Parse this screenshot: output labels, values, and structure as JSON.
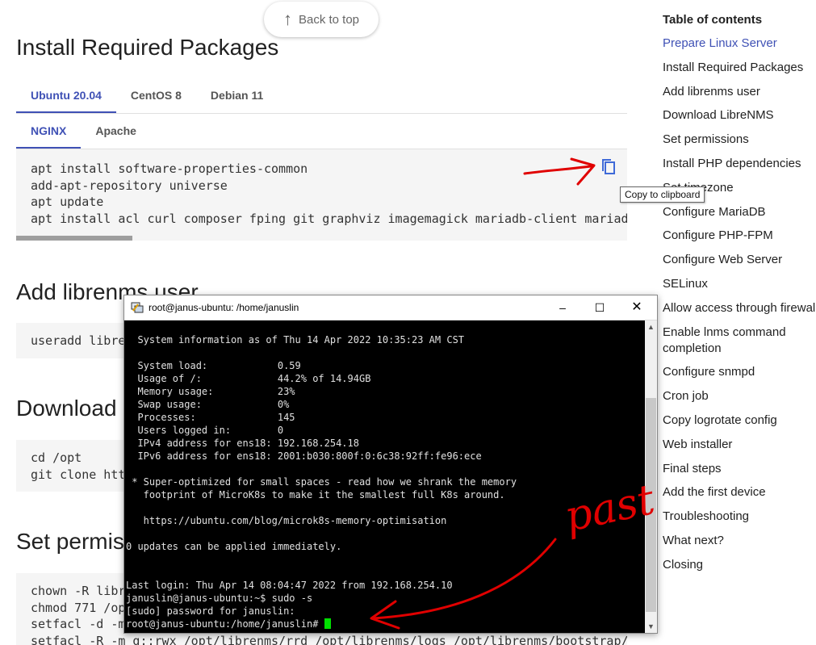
{
  "back_to_top": {
    "label": "Back to top"
  },
  "sections": {
    "install": "Install Required Packages",
    "add_user": "Add librenms user",
    "download": "Download L",
    "permissions": "Set permiss"
  },
  "os_tabs": [
    "Ubuntu 20.04",
    "CentOS 8",
    "Debian 11"
  ],
  "server_tabs": [
    "NGINX",
    "Apache"
  ],
  "install_code": [
    "apt install software-properties-common",
    "add-apt-repository universe",
    "apt update",
    "apt install acl curl composer fping git graphviz imagemagick mariadb-client mariadb"
  ],
  "copy_tooltip": "Copy to clipboard",
  "add_user_code": [
    "useradd libre"
  ],
  "download_code": [
    "cd /opt",
    "git clone htt"
  ],
  "permissions_code": [
    "chown -R libr",
    "chmod 771 /op",
    "setfacl -d -m",
    "setfacl -R -m g::rwx /opt/librenms/rrd /opt/librenms/logs /opt/librenms/bootstrap/c"
  ],
  "toc": {
    "title": "Table of contents",
    "items": [
      "Prepare Linux Server",
      "Install Required Packages",
      "Add librenms user",
      "Download LibreNMS",
      "Set permissions",
      "Install PHP dependencies",
      "Set timezone",
      "Configure MariaDB",
      "Configure PHP-FPM",
      "Configure Web Server",
      "SELinux",
      "Allow access through firewall",
      "Enable lnms command completion",
      "Configure snmpd",
      "Cron job",
      "Copy logrotate config",
      "Web installer",
      "Final steps",
      "Add the first device",
      "Troubleshooting",
      "What next?",
      "Closing"
    ]
  },
  "terminal": {
    "title": "root@janus-ubuntu: /home/januslin",
    "lines": [
      "  System information as of Thu 14 Apr 2022 10:35:23 AM CST",
      "",
      "  System load:            0.59",
      "  Usage of /:             44.2% of 14.94GB",
      "  Memory usage:           23%",
      "  Swap usage:             0%",
      "  Processes:              145",
      "  Users logged in:        0",
      "  IPv4 address for ens18: 192.168.254.18",
      "  IPv6 address for ens18: 2001:b030:800f:0:6c38:92ff:fe96:ece",
      "",
      " * Super-optimized for small spaces - read how we shrank the memory",
      "   footprint of MicroK8s to make it the smallest full K8s around.",
      "",
      "   https://ubuntu.com/blog/microk8s-memory-optimisation",
      "",
      "0 updates can be applied immediately.",
      "",
      "",
      "Last login: Thu Apr 14 08:04:47 2022 from 192.168.254.10",
      "januslin@janus-ubuntu:~$ sudo -s",
      "[sudo] password for januslin:",
      "root@janus-ubuntu:/home/januslin# "
    ]
  },
  "annotation_text": "past",
  "colors": {
    "accent": "#3f51b5",
    "annotation": "#e00000",
    "cursor": "#00e000"
  }
}
